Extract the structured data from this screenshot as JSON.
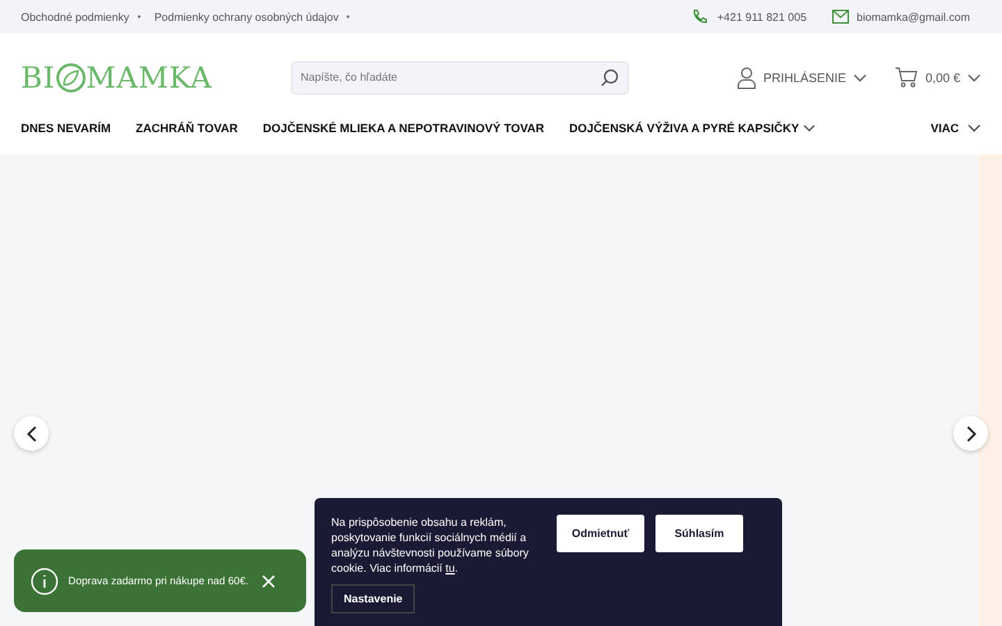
{
  "top_links": [
    "Obchodné podmienky",
    "Podmienky ochrany osobných údajov"
  ],
  "phone": "+421 911 821 005",
  "email": "biomamka@gmail.com",
  "logo": {
    "before": "BI",
    "after": "MAMKA"
  },
  "search": {
    "placeholder": "Napíšte, čo hľadáte"
  },
  "login": "PRIHLÁSENIE",
  "cart": "0,00 €",
  "nav": [
    {
      "label": "DNES NEVARÍM",
      "dropdown": false
    },
    {
      "label": "ZACHRÁŇ TOVAR",
      "dropdown": false
    },
    {
      "label": "DOJČENSKÉ MLIEKA A NEPOTRAVINOVÝ TOVAR",
      "dropdown": false
    },
    {
      "label": "DOJČENSKÁ VÝŽIVA A PYRÉ KAPSIČKY",
      "dropdown": true
    }
  ],
  "nav_more": "VIAC",
  "toast": "Doprava zadarmo pri nákupe nad 60€.",
  "cookie": {
    "text": "Na prispôsobenie obsahu a reklám, poskytovanie funkcií sociálnych médií a analýzu návštevnosti používame súbory cookie. Viac informácií ",
    "link": "tu",
    "end": ".",
    "settings": "Nastavenie",
    "buttons": [
      "Odmietnuť",
      "Súhlasím"
    ]
  }
}
